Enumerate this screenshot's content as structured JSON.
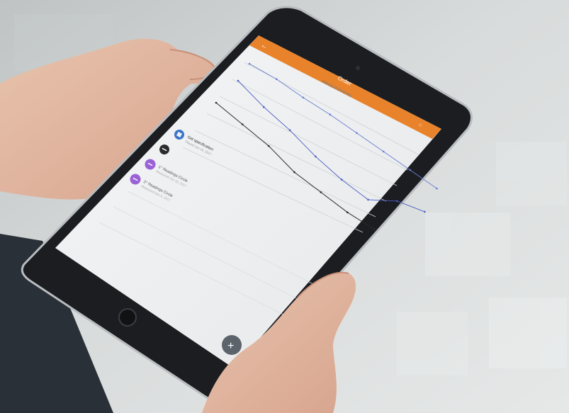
{
  "app": {
    "title": "Order",
    "subtitle": "Measurements",
    "back_icon": "arrow-left-icon",
    "menu_icon": "grid-icon",
    "accent_color": "#e8832c"
  },
  "list": {
    "items": [
      {
        "title": "Gel specification",
        "subtitle": "Placed Jun 16, 2017",
        "icon": "document-icon",
        "color": "#3a74c8"
      },
      {
        "title": "",
        "subtitle": "",
        "icon": "minus-icon",
        "color": "#2b2b2b"
      },
      {
        "title": "1° Readings Circle",
        "subtitle": "Measured Jun 16, 2017",
        "icon": "minus-icon",
        "color": "#9a62d6"
      },
      {
        "title": "2° Readings Circle",
        "subtitle": "Measured Dec 5, 2017",
        "icon": "minus-icon",
        "color": "#9a62d6"
      }
    ]
  },
  "chart_data": {
    "type": "line",
    "title": "",
    "xlabel": "",
    "ylabel": "",
    "grid": true,
    "series": [
      {
        "values": [
          50,
          49,
          46,
          44,
          41,
          38,
          35,
          32
        ]
      },
      {
        "values": [
          46,
          38,
          32,
          24,
          18,
          14,
          22,
          24
        ]
      },
      {
        "values": [
          40,
          35,
          30,
          22,
          18,
          14,
          12
        ]
      }
    ]
  },
  "fab": {
    "icon": "plus-icon"
  }
}
